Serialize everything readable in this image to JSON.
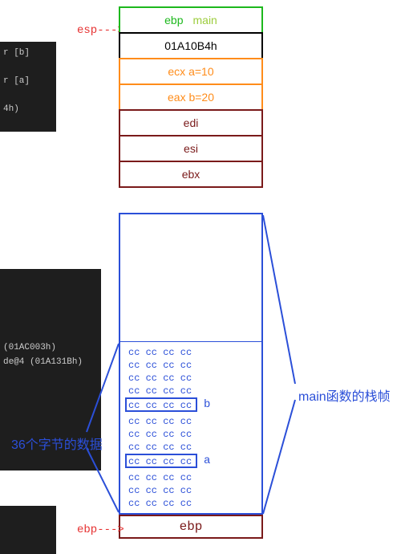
{
  "snippets": {
    "s1_l1": "r [b]",
    "s1_l2": "r [a]",
    "s1_l3": "4h)",
    "s2_l1": "(01AC003h)",
    "s2_l2": "de@4 (01A131Bh)"
  },
  "pointers": {
    "esp": "esp--->",
    "ebp": "ebp--->"
  },
  "cells": {
    "ebp_main_reg": "ebp",
    "ebp_main_sub": "main",
    "ret_addr": "01A10B4h",
    "ecx": "ecx  a=10",
    "eax": "eax  b=20",
    "edi": "edi",
    "esi": "esi",
    "ebx": "ebx",
    "bottom_ebp": "ebp"
  },
  "cc": "cc cc cc cc",
  "var_b": "b",
  "var_a": "a",
  "labels": {
    "left": "36个字节的数据",
    "right": "main函数的栈帧"
  }
}
